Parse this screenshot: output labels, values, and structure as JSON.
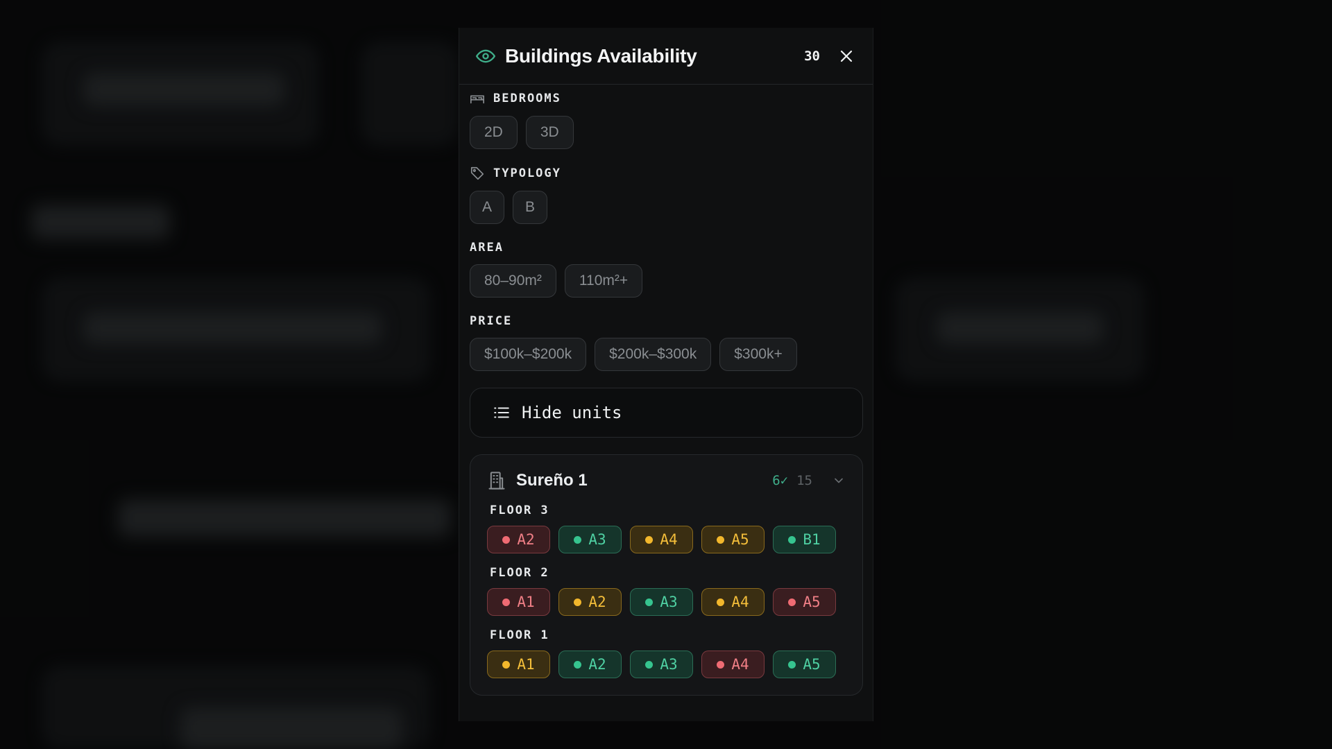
{
  "panel": {
    "title": "Buildings Availability",
    "count": "30",
    "close_icon": "close-icon",
    "header_icon": "eye-icon"
  },
  "filters": {
    "bedrooms": {
      "label": "BEDROOMS",
      "icon": "bed-icon",
      "options": [
        "2D",
        "3D"
      ]
    },
    "typology": {
      "label": "TYPOLOGY",
      "icon": "tag-icon",
      "options": [
        "A",
        "B"
      ]
    },
    "area": {
      "label": "AREA",
      "options": [
        "80–90m²",
        "110m²+"
      ]
    },
    "price": {
      "label": "PRICE",
      "options": [
        "$100k–$200k",
        "$200k–$300k",
        "$300k+"
      ]
    }
  },
  "units_toggle": {
    "label": "Hide units",
    "icon": "list-icon"
  },
  "building": {
    "name": "Sureño 1",
    "available": "6✓",
    "total": "15",
    "floors": [
      {
        "label": "FLOOR 3",
        "units": [
          {
            "code": "A2",
            "status": "sold"
          },
          {
            "code": "A3",
            "status": "available"
          },
          {
            "code": "A4",
            "status": "reserved"
          },
          {
            "code": "A5",
            "status": "reserved"
          },
          {
            "code": "B1",
            "status": "available"
          }
        ]
      },
      {
        "label": "FLOOR 2",
        "units": [
          {
            "code": "A1",
            "status": "sold"
          },
          {
            "code": "A2",
            "status": "reserved"
          },
          {
            "code": "A3",
            "status": "available"
          },
          {
            "code": "A4",
            "status": "reserved"
          },
          {
            "code": "A5",
            "status": "sold"
          }
        ]
      },
      {
        "label": "FLOOR 1",
        "units": [
          {
            "code": "A1",
            "status": "reserved"
          },
          {
            "code": "A2",
            "status": "available"
          },
          {
            "code": "A3",
            "status": "available"
          },
          {
            "code": "A4",
            "status": "sold"
          },
          {
            "code": "A5",
            "status": "available"
          }
        ]
      }
    ]
  },
  "colors": {
    "available": "#36c48f",
    "reserved": "#f2b72c",
    "sold": "#ef6b73",
    "accent": "#3fae8a"
  }
}
